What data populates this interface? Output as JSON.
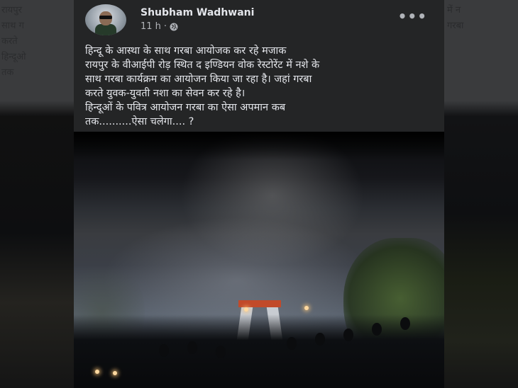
{
  "post": {
    "author": "Shubham Wadhwani",
    "time": "11 h",
    "separator": "·",
    "more_label": "•••",
    "text_lines": [
      "हिन्दू के आस्था के साथ गरबा आयोजक कर रहे मजाक",
      "रायपुर के वीआईपी रोड़ स्थित द इण्डियन वोक रेस्टोरेंट में नशे के",
      "साथ गरबा कार्यक्रम का आयोजन किया जा रहा है। जहां गरबा",
      "करते युवक-युवती नशा का सेवन कर रहे है।",
      "हिन्दूओं के पवित्र आयोजन गरबा का ऐसा अपमान कब",
      "तक..........ऐसा चलेगा.... ?"
    ]
  },
  "background_ghost_left": [
    "रायपुर",
    "साथ ग",
    "करते",
    "हिन्दूओ",
    "तक"
  ],
  "background_ghost_right": [
    "में न",
    "गरबा"
  ],
  "colors": {
    "card": "#242526",
    "text_primary": "#e4e6eb",
    "text_secondary": "#b0b3b8"
  },
  "icons": [
    "globe-icon",
    "more-options-icon",
    "avatar"
  ]
}
